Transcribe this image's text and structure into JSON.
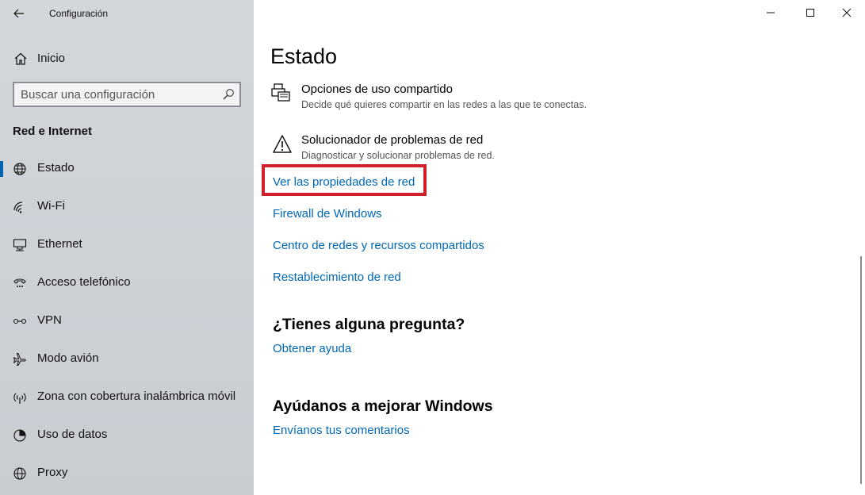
{
  "window": {
    "title": "Configuración",
    "controls": {
      "minimize": "minimize",
      "maximize": "maximize",
      "close": "close"
    }
  },
  "sidebar": {
    "home_label": "Inicio",
    "search": {
      "placeholder": "Buscar una configuración"
    },
    "section_title": "Red e Internet",
    "items": [
      {
        "label": "Estado",
        "icon": "globe-icon",
        "selected": true
      },
      {
        "label": "Wi-Fi",
        "icon": "wifi-icon",
        "selected": false
      },
      {
        "label": "Ethernet",
        "icon": "ethernet-icon",
        "selected": false
      },
      {
        "label": "Acceso telefónico",
        "icon": "dialup-icon",
        "selected": false
      },
      {
        "label": "VPN",
        "icon": "vpn-icon",
        "selected": false
      },
      {
        "label": "Modo avión",
        "icon": "airplane-icon",
        "selected": false
      },
      {
        "label": "Zona con cobertura inalámbrica móvil",
        "icon": "hotspot-icon",
        "selected": false
      },
      {
        "label": "Uso de datos",
        "icon": "data-usage-icon",
        "selected": false
      },
      {
        "label": "Proxy",
        "icon": "proxy-icon",
        "selected": false
      }
    ]
  },
  "main": {
    "title": "Estado",
    "options": [
      {
        "title": "Opciones de uso compartido",
        "description": "Decide qué quieres compartir en las redes a las que te conectas.",
        "icon": "sharing-printer-icon"
      },
      {
        "title": "Solucionador de problemas de red",
        "description": "Diagnosticar y solucionar problemas de red.",
        "icon": "warning-icon"
      }
    ],
    "links": [
      "Ver las propiedades de red",
      "Firewall de Windows",
      "Centro de redes y recursos compartidos",
      "Restablecimiento de red"
    ],
    "question_section": {
      "heading": "¿Tienes alguna pregunta?",
      "link": "Obtener ayuda"
    },
    "improve_section": {
      "heading": "Ayúdanos a mejorar Windows",
      "link": "Envíanos tus comentarios"
    }
  },
  "colors": {
    "accent": "#0063b1",
    "link": "#0068b8",
    "highlight": "#d0202a",
    "sidebar_bg": "#cfd3d8"
  }
}
